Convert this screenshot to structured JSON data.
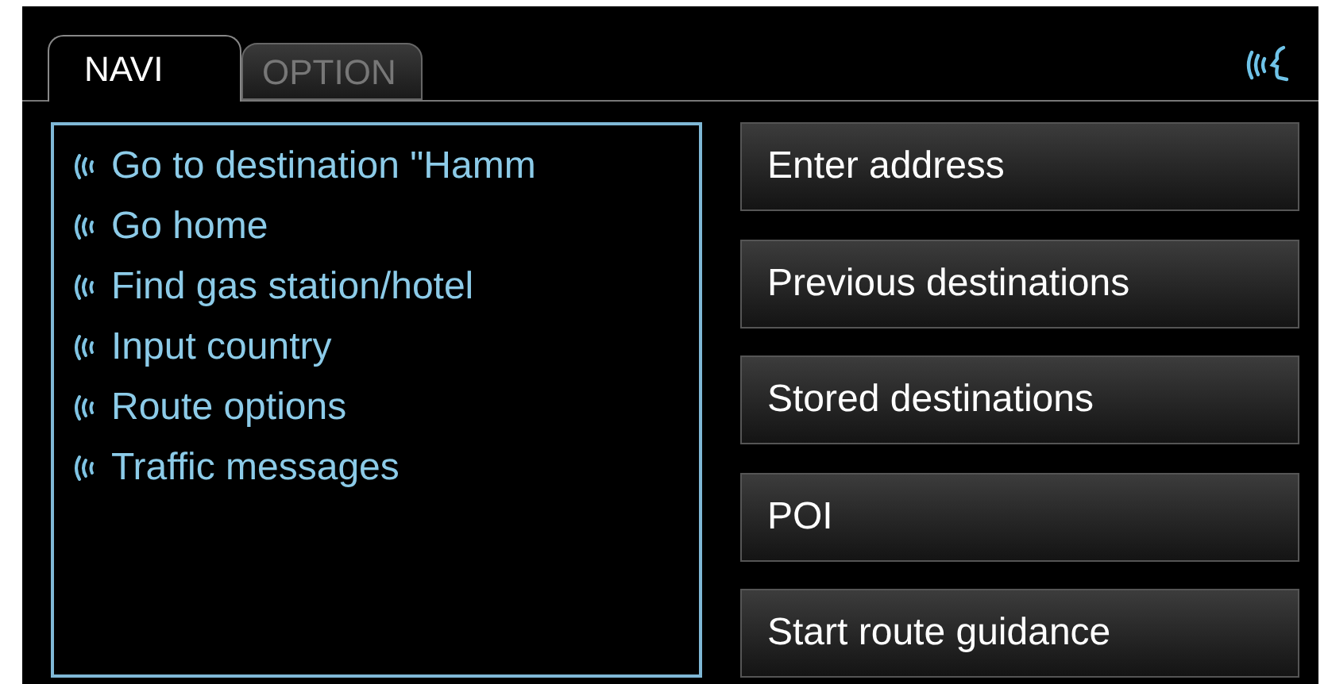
{
  "tabs": [
    {
      "label": "NAVI",
      "selected": true
    },
    {
      "label": "OPTION",
      "selected": false
    }
  ],
  "voice_commands": [
    {
      "label": "Go to destination \"Hamm"
    },
    {
      "label": "Go home"
    },
    {
      "label": "Find gas station/hotel"
    },
    {
      "label": "Input country"
    },
    {
      "label": "Route options"
    },
    {
      "label": "Traffic messages"
    }
  ],
  "menu_buttons": [
    {
      "label": "Enter address"
    },
    {
      "label": "Previous destinations"
    },
    {
      "label": "Stored destinations"
    },
    {
      "label": "POI"
    },
    {
      "label": "Start route guidance"
    }
  ]
}
